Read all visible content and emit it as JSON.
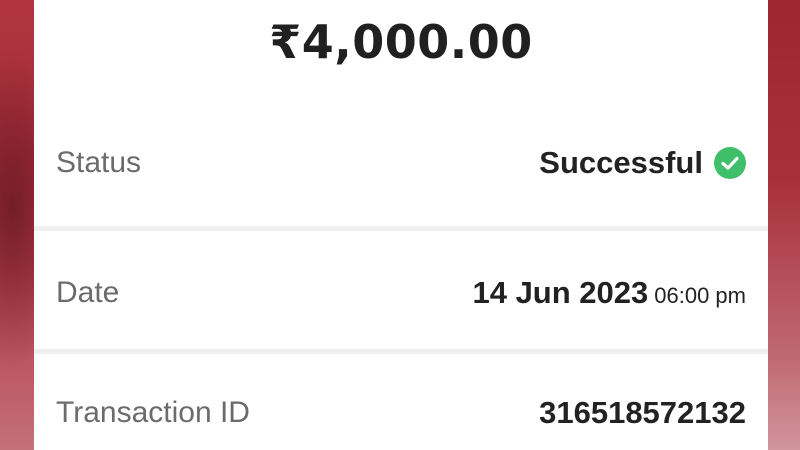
{
  "transaction": {
    "amount": "₹4,000.00",
    "status_label": "Status",
    "status_value": "Successful",
    "status_icon": "check-circle-icon",
    "date_label": "Date",
    "date_value": "14 Jun 2023",
    "time_value": "06:00 pm",
    "txn_label": "Transaction ID",
    "txn_value": "316518572132"
  },
  "colors": {
    "success": "#3fbf6a",
    "background": "#b0353f"
  }
}
